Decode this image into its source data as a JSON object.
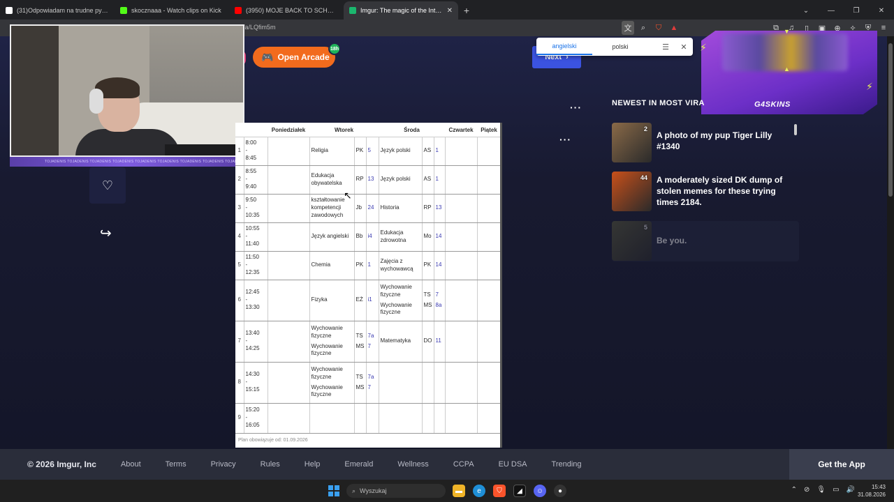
{
  "browser": {
    "tabs": [
      {
        "title": "(31)Odpowiadam na trudne pytania",
        "color": "#ffffff",
        "active": false
      },
      {
        "title": "skocznaaa - Watch clips on Kick",
        "color": "#53fc18",
        "active": false
      },
      {
        "title": "(3950) MOJE BACK TO SCHOOL (tak",
        "color": "#ff0000",
        "active": false
      },
      {
        "title": "Imgur: The magic of the Internet",
        "color": "#1bb76e",
        "active": true
      }
    ],
    "url": "/a/LQfim5m"
  },
  "translate_popup": {
    "source_lang": "angielski",
    "target_lang": "polski"
  },
  "arcade": {
    "label": "Open Arcade",
    "badge": "18h"
  },
  "next_button": {
    "label": "Next"
  },
  "ad": {
    "brand": "G4SKINS"
  },
  "timetable": {
    "headers": [
      "Poniedziałek",
      "Wtorek",
      "Środa",
      "Czwartek",
      "Piątek"
    ],
    "rows": [
      {
        "num": "1",
        "time": "8:00\n-\n8:45",
        "tue": [
          {
            "subject": "Religia",
            "teacher": "PK",
            "room": "5"
          }
        ],
        "wed": [
          {
            "subject": "Język polski",
            "teacher": "AS",
            "room": "1"
          }
        ]
      },
      {
        "num": "2",
        "time": "8:55\n-\n9:40",
        "tue": [
          {
            "subject": "Edukacja obywatelska",
            "teacher": "RP",
            "room": "13"
          }
        ],
        "wed": [
          {
            "subject": "Język polski",
            "teacher": "AS",
            "room": "1"
          }
        ]
      },
      {
        "num": "3",
        "time": "9:50\n-\n10:35",
        "tue": [
          {
            "subject": "kształtowanie kompetencji zawodowych",
            "teacher": "Jb",
            "room": "24"
          }
        ],
        "wed": [
          {
            "subject": "Historia",
            "teacher": "RP",
            "room": "13"
          }
        ]
      },
      {
        "num": "4",
        "time": "10:55\n-\n11:40",
        "tue": [
          {
            "subject": "Język angielski",
            "teacher": "Bb",
            "room": "i4"
          }
        ],
        "wed": [
          {
            "subject": "Edukacja zdrowotna",
            "teacher": "Mo",
            "room": "14"
          }
        ]
      },
      {
        "num": "5",
        "time": "11:50\n-\n12:35",
        "tue": [
          {
            "subject": "Chemia",
            "teacher": "PK",
            "room": "1"
          }
        ],
        "wed": [
          {
            "subject": "Zajęcia z wychowawcą",
            "teacher": "PK",
            "room": "14"
          }
        ]
      },
      {
        "num": "6",
        "time": "12:45\n-\n13:30",
        "tue": [
          {
            "subject": "Fizyka",
            "teacher": "EŻ",
            "room": "i1"
          }
        ],
        "wed": [
          {
            "subject": "Wychowanie fizyczne",
            "teacher": "TS",
            "room": "7"
          },
          {
            "subject": "Wychowanie fizyczne",
            "teacher": "MS",
            "room": "8a"
          }
        ]
      },
      {
        "num": "7",
        "time": "13:40\n-\n14:25",
        "tue": [
          {
            "subject": "Wychowanie fizyczne",
            "teacher": "TS",
            "room": "7a"
          },
          {
            "subject": "Wychowanie fizyczne",
            "teacher": "MS",
            "room": "7"
          }
        ],
        "wed": [
          {
            "subject": "Matematyka",
            "teacher": "DO",
            "room": "11"
          }
        ]
      },
      {
        "num": "8",
        "time": "14:30\n-\n15:15",
        "tue": [
          {
            "subject": "Wychowanie fizyczne",
            "teacher": "TS",
            "room": "7a"
          },
          {
            "subject": "Wychowanie fizyczne",
            "teacher": "MS",
            "room": "7"
          }
        ],
        "wed": []
      },
      {
        "num": "9",
        "time": "15:20\n-\n16:05",
        "tue": [],
        "wed": []
      }
    ],
    "footer": "Plan obowiązuje od: 01.09.2026"
  },
  "newest": {
    "title": "NEWEST IN MOST VIRA",
    "posts": [
      {
        "count": "2",
        "title": "A photo of my pup Tiger Lilly #1340",
        "thumb_color": "#8a6a48"
      },
      {
        "count": "44",
        "title": "A moderately sized DK dump of stolen memes for these trying times 2184.",
        "thumb_color": "#c8501a"
      },
      {
        "count": "5",
        "title": "Be you.",
        "thumb_color": "#5a5a3a"
      }
    ]
  },
  "footer": {
    "copyright": "© 2026 Imgur, Inc",
    "links": [
      "About",
      "Terms",
      "Privacy",
      "Rules",
      "Help",
      "Emerald",
      "Wellness",
      "CCPA",
      "EU DSA",
      "Trending"
    ],
    "app_button": "Get the App"
  },
  "webcam": {
    "strip_text": "TOJADENIS TOJADENIS TOJADENIS TOJADENIS TOJADENIS TOJADENIS TOJADENIS TOJADENIS TOJADENIS TOJADENIS TOJADENIS"
  },
  "taskbar": {
    "search_placeholder": "Wyszukaj",
    "time": "15:43",
    "date": "31.08.2026"
  }
}
